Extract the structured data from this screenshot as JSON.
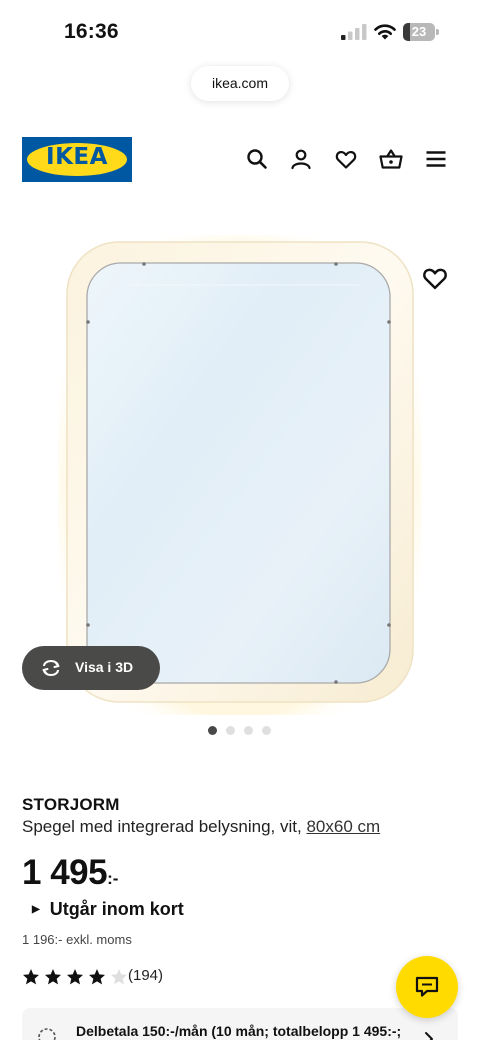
{
  "status_bar": {
    "time": "16:36",
    "battery_level": "23",
    "icons": [
      "cellular-signal-icon",
      "wifi-icon",
      "battery-icon"
    ]
  },
  "browser": {
    "url": "ikea.com"
  },
  "header": {
    "logo_text": "IKEA",
    "brand_colors": {
      "blue": "#0058a3",
      "yellow": "#ffda1a"
    },
    "icons": [
      "search-icon",
      "account-icon",
      "wishlist-heart-icon",
      "shopping-basket-icon",
      "menu-icon"
    ]
  },
  "gallery": {
    "view_3d_label": "Visa i 3D",
    "image_count": 4,
    "active_index": 0,
    "favorite_icon": "heart-outline-icon"
  },
  "product": {
    "name": "STORJORM",
    "description": "Spegel med integrerad belysning, vit, ",
    "size": "80x60 cm",
    "price": "1 495",
    "price_suffix": ":-",
    "availability": "Utgår inom kort",
    "price_excl_vat": "1 196:- exkl. moms",
    "rating": 4,
    "rating_max": 5,
    "review_count": "(194)"
  },
  "installment": {
    "text": "Delbetala 150:-/mån (10 mån; totalbelopp 1 495:-;"
  },
  "chat": {
    "icon": "chat-bubble-icon",
    "color": "#ffdb00"
  }
}
